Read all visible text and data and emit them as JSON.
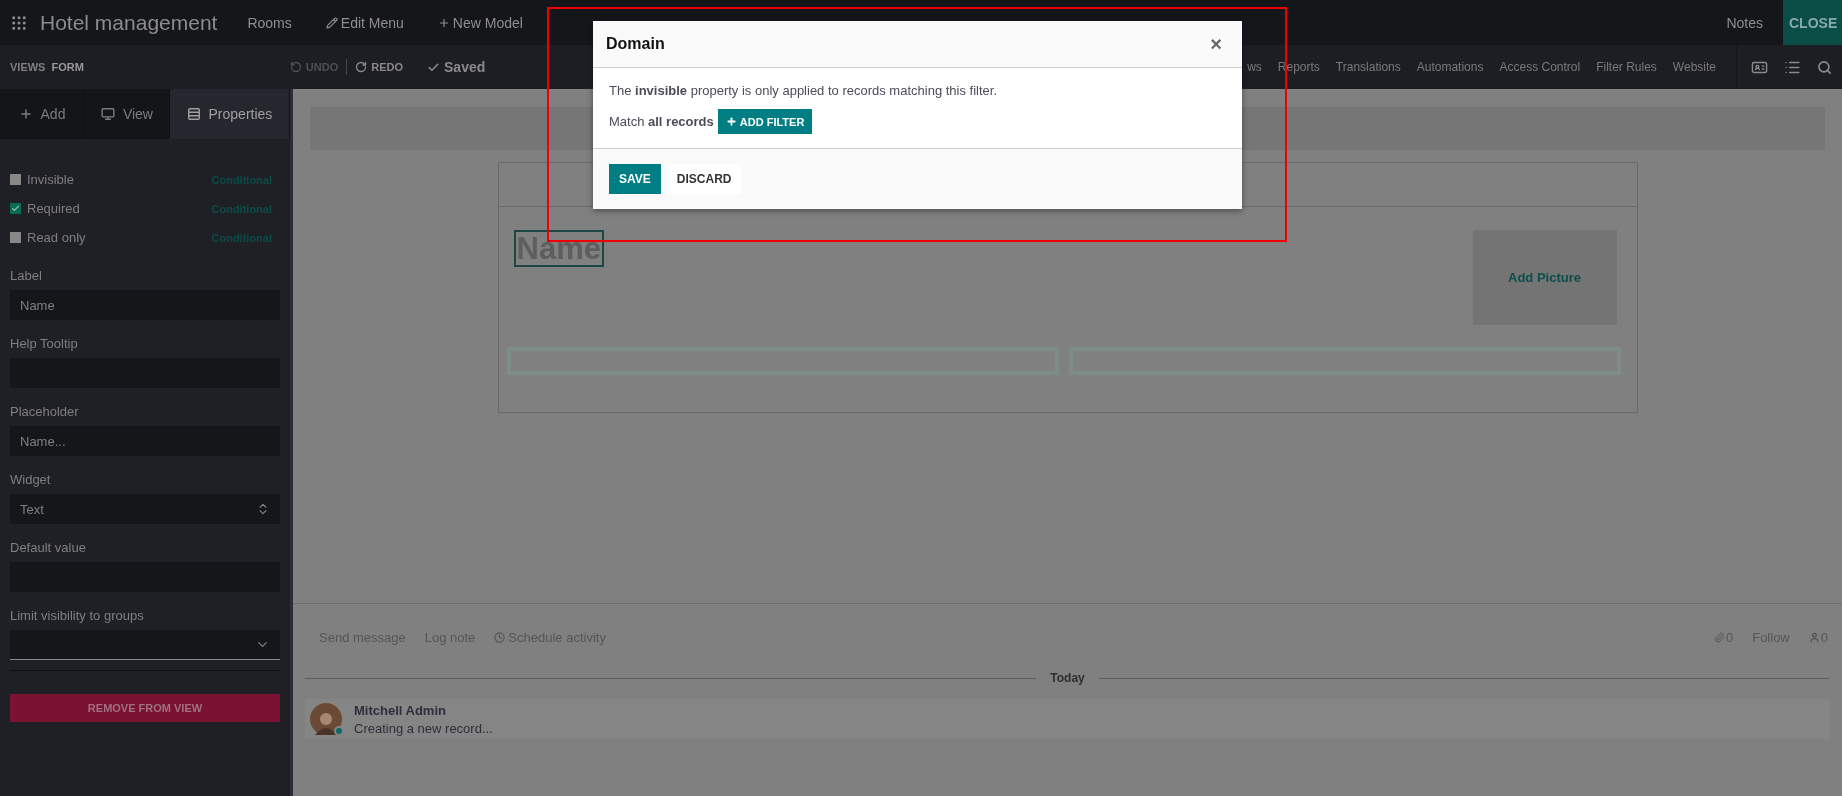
{
  "app": {
    "title": "Hotel management",
    "menu": [
      {
        "label": "Rooms"
      },
      {
        "label": "Edit Menu"
      },
      {
        "label": "New Model"
      }
    ],
    "notes": "Notes",
    "close": "CLOSE"
  },
  "toolbar": {
    "views_label": "VIEWS",
    "view_name": "FORM",
    "undo": {
      "label": "UNDO",
      "disabled": true
    },
    "redo": {
      "label": "REDO",
      "disabled": false
    },
    "saved": "Saved",
    "menu": [
      "ws",
      "Reports",
      "Translations",
      "Automations",
      "Access Control",
      "Filter Rules",
      "Website"
    ]
  },
  "sidebar": {
    "tabs": [
      {
        "label": "Add",
        "selected": false
      },
      {
        "label": "View",
        "selected": false
      },
      {
        "label": "Properties",
        "selected": true
      }
    ],
    "properties": [
      {
        "label": "Invisible",
        "checked": false,
        "link": "Conditional"
      },
      {
        "label": "Required",
        "checked": true,
        "link": "Conditional"
      },
      {
        "label": "Read only",
        "checked": false,
        "link": "Conditional"
      }
    ],
    "fields": [
      {
        "kind": "input",
        "label": "Label",
        "value": "Name"
      },
      {
        "kind": "input",
        "label": "Help Tooltip"
      },
      {
        "kind": "input",
        "label": "Placeholder",
        "value": "Name..."
      },
      {
        "kind": "select",
        "label": "Widget",
        "value": "Text"
      },
      {
        "kind": "input",
        "label": "Default value"
      },
      {
        "kind": "dropdown",
        "label": "Limit visibility to groups"
      }
    ],
    "remove_button": "REMOVE FROM VIEW"
  },
  "form": {
    "title": "Name",
    "picture_button": "Add Picture"
  },
  "chatter": {
    "actions": [
      {
        "label": "Send message"
      },
      {
        "label": "Log note"
      },
      {
        "label": "Schedule activity"
      }
    ],
    "attachments": "0",
    "follow": "Follow",
    "followers": "0",
    "date_separator": "Today",
    "messages": [
      {
        "author": "Mitchell Admin",
        "body": "Creating a new record...",
        "online": true
      }
    ]
  },
  "dialog": {
    "title": "Domain",
    "close": "×",
    "description": "The **invisible** property is only applied to records matching this filter.",
    "match": "Match **all records**",
    "add_filter": "ADD FILTER",
    "buttons": [
      {
        "label": "SAVE",
        "kind": "primary"
      },
      {
        "label": "DISCARD",
        "kind": "secondary"
      }
    ]
  }
}
